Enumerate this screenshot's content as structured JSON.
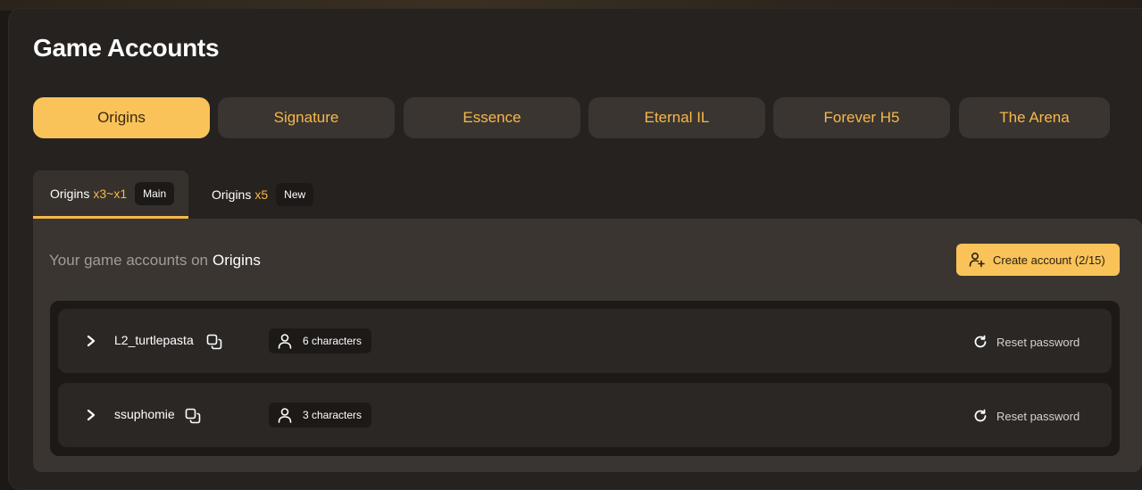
{
  "page": {
    "title": "Game Accounts"
  },
  "server_tabs": [
    {
      "label": "Origins",
      "active": true
    },
    {
      "label": "Signature",
      "active": false
    },
    {
      "label": "Essence",
      "active": false
    },
    {
      "label": "Eternal IL",
      "active": false
    },
    {
      "label": "Forever H5",
      "active": false
    },
    {
      "label": "The Arena",
      "active": false
    }
  ],
  "sub_tabs": [
    {
      "name": "Origins",
      "rate": "x3~x1",
      "badge": "Main",
      "active": true
    },
    {
      "name": "Origins",
      "rate": "x5",
      "badge": "New",
      "active": false
    }
  ],
  "content": {
    "intro_prefix": "Your game accounts on",
    "intro_server": "Origins",
    "create_button": "Create account (2/15)"
  },
  "accounts": [
    {
      "name": "L2_turtlepasta",
      "characters": "6 characters",
      "reset_label": "Reset password"
    },
    {
      "name": "ssuphomie",
      "characters": "3 characters",
      "reset_label": "Reset password"
    }
  ],
  "colors": {
    "accent": "#f9c35a",
    "accent_text": "#f7b84a",
    "panel": "#26221f",
    "card": "#3a3531",
    "row": "#2b2724"
  }
}
